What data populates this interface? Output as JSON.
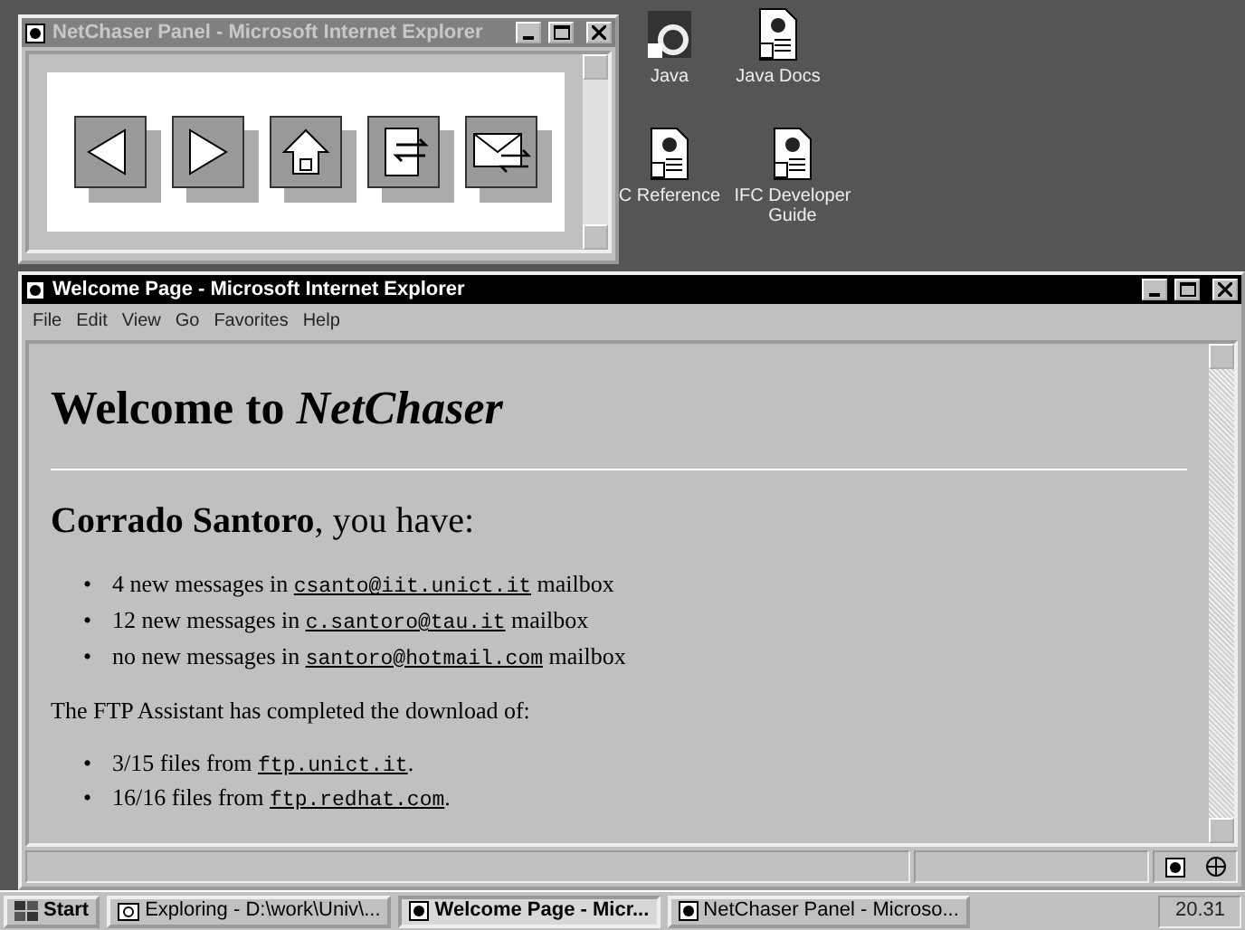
{
  "panel_window": {
    "title": "NetChaser Panel - Microsoft Internet Explorer",
    "buttons": [
      {
        "kind": "back"
      },
      {
        "kind": "forward"
      },
      {
        "kind": "home"
      },
      {
        "kind": "transfer"
      },
      {
        "kind": "mail"
      }
    ]
  },
  "desktop_icons": [
    {
      "label": "Java",
      "kind": "java"
    },
    {
      "label": "Java Docs",
      "kind": "doc"
    },
    {
      "label": "C Reference",
      "kind": "doc"
    },
    {
      "label": "IFC Developer Guide",
      "kind": "doc"
    }
  ],
  "browser": {
    "title": "Welcome Page - Microsoft Internet Explorer",
    "menu": [
      "File",
      "Edit",
      "View",
      "Go",
      "Favorites",
      "Help"
    ],
    "heading": "Welcome to *NetChaser*",
    "greeting": "**Corrado Santoro**, you have:",
    "messages": [
      {
        "marker": "•",
        "before": "4 new messages in",
        "link": "csanto@iit.unict.it",
        "after": " mailbox"
      },
      {
        "marker": "•",
        "before": "12 new messages in",
        "link": "c.santoro@tau.it",
        "after": " mailbox"
      },
      {
        "marker": "•",
        "before": "no new messages in",
        "link": "santoro@hotmail.com",
        "after": " mailbox"
      }
    ],
    "ftp_intro": "The FTP Assistant has completed the download of:",
    "downloads": [
      {
        "marker": "•",
        "before": "3/15 files from",
        "link": "ftp.unict.it",
        "after": "."
      },
      {
        "marker": "•",
        "before": "16/16 files from",
        "link": "ftp.redhat.com",
        "after": "."
      }
    ]
  },
  "taskbar": {
    "start": "Start",
    "tasks": [
      {
        "label": "Exploring - D:\\work\\Univ\\...",
        "kind": "explorer",
        "selected": false
      },
      {
        "label": "Welcome Page - Micr...",
        "kind": "ie",
        "selected": true
      },
      {
        "label": "NetChaser Panel - Microso...",
        "kind": "ie",
        "selected": false
      }
    ],
    "clock": "20.31"
  }
}
